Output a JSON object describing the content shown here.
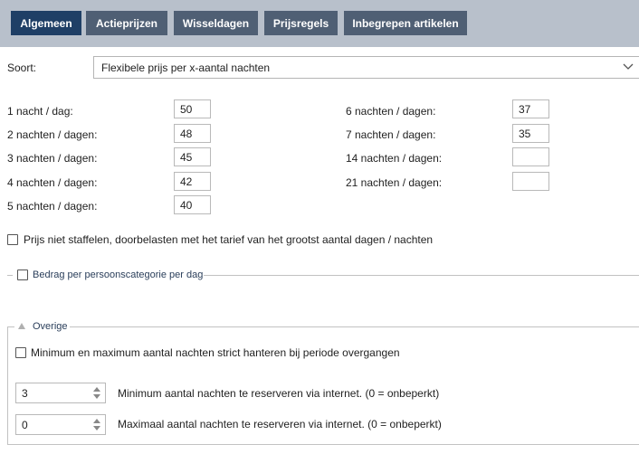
{
  "tabs": [
    {
      "label": "Algemeen",
      "active": true
    },
    {
      "label": "Actieprijzen",
      "active": false
    },
    {
      "label": "Wisseldagen",
      "active": false
    },
    {
      "label": "Prijsregels",
      "active": false
    },
    {
      "label": "Inbegrepen artikelen",
      "active": false
    }
  ],
  "soort": {
    "label": "Soort:",
    "value": "Flexibele prijs per x-aantal nachten"
  },
  "prices_left": [
    {
      "label": "1 nacht / dag:",
      "value": "50"
    },
    {
      "label": "2 nachten / dagen:",
      "value": "48"
    },
    {
      "label": "3 nachten / dagen:",
      "value": "45"
    },
    {
      "label": "4 nachten / dagen:",
      "value": "42"
    },
    {
      "label": "5 nachten / dagen:",
      "value": "40"
    }
  ],
  "prices_right": [
    {
      "label": "6 nachten / dagen:",
      "value": "37"
    },
    {
      "label": "7 nachten / dagen:",
      "value": "35"
    },
    {
      "label": "14 nachten / dagen:",
      "value": ""
    },
    {
      "label": "21 nachten / dagen:",
      "value": ""
    }
  ],
  "no_staffel": {
    "label": "Prijs niet staffelen, doorbelasten met het tarief van het grootst aantal dagen / nachten",
    "checked": false
  },
  "per_person_section": {
    "legend": "Bedrag per persoonscategorie per dag",
    "checked": false
  },
  "overige_section": {
    "legend": "Overige",
    "strict_label": "Minimum en maximum aantal nachten strict hanteren bij periode overgangen",
    "strict_checked": false,
    "min_value": "3",
    "min_label": "Minimum aantal nachten te reserveren via internet. (0 = onbeperkt)",
    "max_value": "0",
    "max_label": "Maximaal aantal nachten te reserveren via internet. (0 = onbeperkt)"
  },
  "colors": {
    "tabbar_bg": "#b8c0cb",
    "tab_bg": "#4f5f74",
    "tab_active_bg": "#1f3f66",
    "legend_text": "#2a3e5a"
  },
  "icons": {
    "dropdown": "chevron-down-icon",
    "collapse": "triangle-up-icon",
    "spinner": "spinner-arrows-icon"
  }
}
